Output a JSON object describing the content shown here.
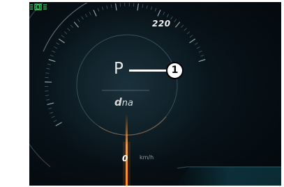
{
  "cluster": {
    "speed_scale_max": "220",
    "gear": "P",
    "drive_mode_first": "d",
    "drive_mode_rest": "na",
    "speed_value": "0",
    "speed_unit": "km/h",
    "callout_number": "1"
  },
  "icons": {
    "lights_indicator": "low-beam-headlight-icon"
  },
  "colors": {
    "background": "#071016",
    "needle": "#ff9a3c",
    "indicator_green": "#3fe06a",
    "text": "#e8e8e8",
    "bar_teal": "#0f3b46"
  }
}
